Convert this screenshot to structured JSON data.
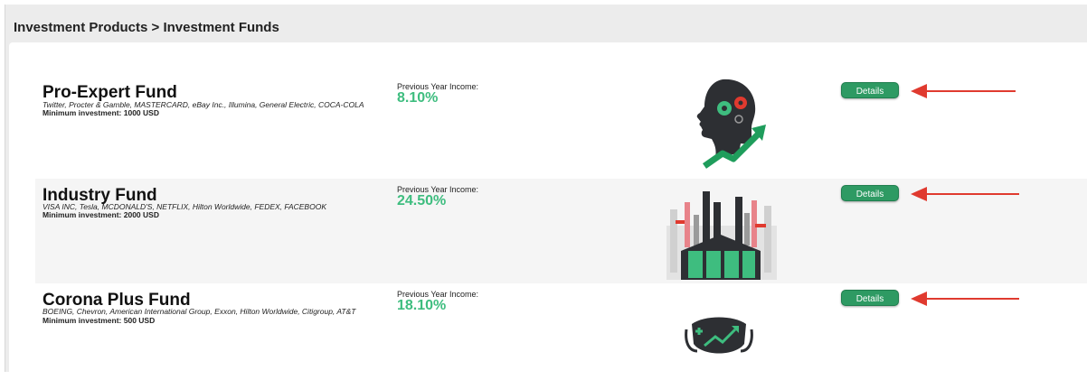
{
  "breadcrumb": "Investment Products > Investment Funds",
  "income_label": "Previous Year Income:",
  "details_label": "Details",
  "min_label": "Minimum investment:",
  "colors": {
    "accent": "#3ebd7f",
    "button": "#2e9a63",
    "arrow": "#e03a2f"
  },
  "funds": [
    {
      "name": "Pro-Expert Fund",
      "companies": "Twitter, Procter & Gamble, MASTERCARD, eBay Inc., Illumina, General Electric, COCA-COLA",
      "min_value": "1000 USD",
      "income": "8.10%",
      "image_icon": "head-gears-growth-icon"
    },
    {
      "name": "Industry Fund",
      "companies": "VISA INC, Tesla, MCDONALD'S, NETFLIX, Hilton Worldwide, FEDEX, FACEBOOK",
      "min_value": "2000 USD",
      "income": "24.50%",
      "image_icon": "factory-icon"
    },
    {
      "name": "Corona Plus Fund",
      "companies": "BOEING, Chevron, American International Group, Exxon, Hilton Worldwide, Citigroup, AT&T",
      "min_value": "500 USD",
      "income": "18.10%",
      "image_icon": "face-mask-growth-icon"
    }
  ]
}
